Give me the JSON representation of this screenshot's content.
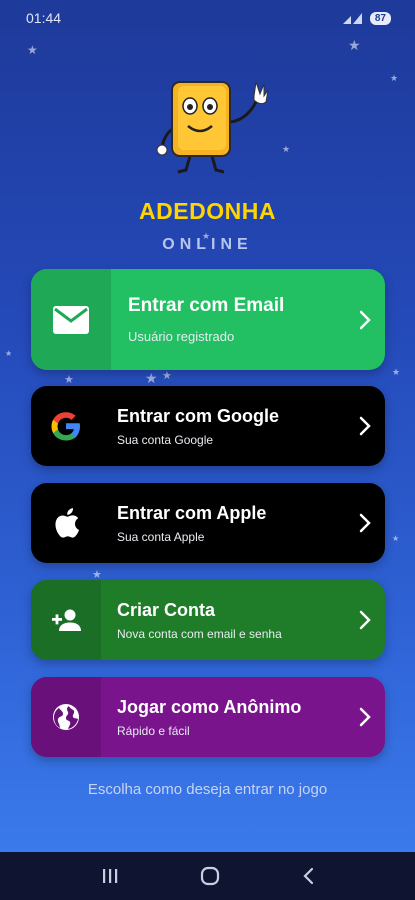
{
  "status": {
    "time": "01:44",
    "battery": "87"
  },
  "app": {
    "title": "ADEDONHA",
    "subtitle": "ONLINE"
  },
  "buttons": [
    {
      "id": "email",
      "title": "Entrar com Email",
      "subtitle": "Usuário registrado",
      "icon": "mail-icon",
      "color": "#22c063"
    },
    {
      "id": "google",
      "title": "Entrar com Google",
      "subtitle": "Sua conta Google",
      "icon": "google-icon",
      "color": "#000000"
    },
    {
      "id": "apple",
      "title": "Entrar com Apple",
      "subtitle": "Sua conta Apple",
      "icon": "apple-icon",
      "color": "#000000"
    },
    {
      "id": "signup",
      "title": "Criar Conta",
      "subtitle": "Nova conta com email e senha",
      "icon": "person-add-icon",
      "color": "#1f7d2a"
    },
    {
      "id": "anon",
      "title": "Jogar como Anônimo",
      "subtitle": "Rápido e fácil",
      "icon": "globe-icon",
      "color": "#7a148c"
    }
  ],
  "footer": {
    "hint": "Escolha como deseja entrar no jogo"
  },
  "navbar": {
    "icons": [
      "recent-apps-icon",
      "home-icon",
      "back-icon"
    ]
  }
}
